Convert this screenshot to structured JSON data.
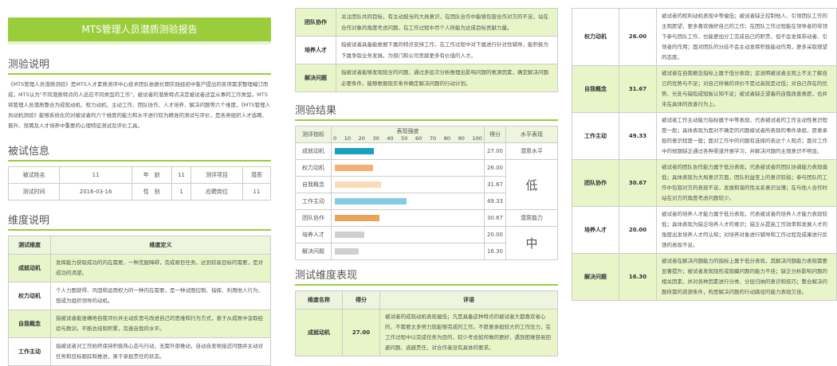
{
  "report_title": "MTS管理人员潜质测验报告",
  "section_intro": "测验说明",
  "intro_text": "《MTS管理人员潜质测验》是MTS人才素质测评中心技术团队依据长期实践经验中客户提出的各项需求整理编订而成，MTS认为\"不同潜质特点的人适应不同类型的工作\"，被试者的潜质特点决定被试者适宜从事的工作类型。MTS将管理人员潜质整合为成就动机、权力动机、主动工作、团队协作、人才培养、解决问题等六个维度，《MTS管理人员动机测验》能够系统化的对被试者的六个维度的能力和水平进行较为精准的测试与评价，是各类组织人才选聘、晋升、竞聘及人才培养中重要的心理特征测试及评价工具。",
  "section_info": "被试信息",
  "info": {
    "name_label": "被试姓名",
    "name": "11",
    "age_label": "年　龄",
    "age": "11",
    "item_label": "测评项目",
    "item": "潜质",
    "time_label": "测试时间",
    "time": "2016-03-16",
    "gender_label": "性　别",
    "gender": "1",
    "position_label": "应聘岗位",
    "position": "11"
  },
  "section_dim": "维度说明",
  "dim_header": {
    "name": "测试维度",
    "def": "维度定义"
  },
  "dimensions": [
    {
      "name": "成就动机",
      "def": "发挥能力获取成功的内在需要，一种克服障碍，完成艰巨任务，达到较高目标的需要，是对成功的渴望。"
    },
    {
      "name": "权力动机",
      "def": "个人力图获得、巩固和运用权力的一种内在需要，是一种试图控制、指挥、利用他人行为，想成为组织领导的动机。"
    },
    {
      "name": "自我概念",
      "def": "指被试者能准确地自我评价并主动反思与改进自己的思维和行为方式，善于从成败中汲取经验与教训，不断总结和积累，完善自我的水平。"
    },
    {
      "name": "工作主动",
      "def": "指被试者对工作始终保持积极热心态与行动，无需外部推动，自动自发地接近问题并主动对任务和目标跟踪和推进，勇于承担责任的状态。"
    }
  ],
  "dimensions_cont": [
    {
      "name": "团队协作",
      "def": "关注团队共同目标，有主动担当的大局意识，在团队合作中能够包容合作对方的不足，站在合作对象的角度考虑问题，在工作过程中尽个人所能为达成目标贡献力量。"
    },
    {
      "name": "培养人才",
      "def": "指被试者具备能根据下属的特点安排工作，在工作过程中对下属进行针对性辅导，能积极为下属争取业务发展。为部门和公司贡献更多有价值的人才。"
    },
    {
      "name": "解决问题",
      "def": "指被试者能够发现隐含的问题，通过多层次分析推理出影响问题的根源因素，确定解决问题必要条件，能够根据现实条件确定解决问题的行动计划。"
    }
  ],
  "section_result": "测验结果",
  "result_header": {
    "indicator": "测评指标",
    "strength": "表现强度",
    "score": "得分",
    "level": "水平表现"
  },
  "chart_data": {
    "type": "bar",
    "orientation": "horizontal",
    "xlabel": "表现强度",
    "xlim": [
      0,
      100
    ],
    "ticks": [
      "0",
      "10",
      "20",
      "30",
      "40",
      "50",
      "60",
      "70",
      "80",
      "90",
      "100"
    ],
    "categories": [
      "成就动机",
      "权力动机",
      "自我概念",
      "工作主动",
      "团队协作",
      "培养人才",
      "解决问题"
    ],
    "values": [
      27.0,
      26.0,
      31.67,
      49.33,
      30.67,
      20.0,
      16.3
    ],
    "score_labels": [
      "27.00",
      "26.00",
      "31.67",
      "49.33",
      "30.67",
      "20.00",
      "16.30"
    ],
    "colors": [
      "#1aa0c2",
      "#f3ae74",
      "#fcdcb8",
      "#84cbe8",
      "#e8a45a",
      "#cfcfcf",
      "#cfcfcf"
    ]
  },
  "levels": {
    "l1": "潜质水平",
    "l2": "低",
    "l3": "潜质能力",
    "l4": "中"
  },
  "section_eval": "测试维度表现",
  "eval_header": {
    "name": "维度名称",
    "score": "得分",
    "comment": "评语"
  },
  "evaluations": [
    {
      "name": "成就动机",
      "score": "27.00",
      "comment": "被试者的成就动机表现偏低；凡是具备这种特点的被试者大都喜欢省心的、不需要太多努力就能够完成的工作。不愿意承担较大的工作压力，在工作过程中以完成任务为目的，较少考虑如何做的更好，遇到困难容易回避问题、逃避责任，对合作者没有具体的要求。"
    },
    {
      "name": "权力动机",
      "score": "26.00",
      "comment": "被试者的权利动机表现中等偏低；被试者缺乏控制他人、引领团队工作的主观愿望，更多喜欢做好自己的工作；在团队工作过程能在领导者的带领下参与团队工作，也能更加分工完成自己的职责，但不会发挥带动者、引领者的作用；面对团队的分歧不会主动发挥积极能动作用，更多采取观望的态度。"
    },
    {
      "name": "自我概念",
      "score": "31.67",
      "comment": "被试者在自我概念指标上属于低分表现；这说明被试者主观上不太了解自己的优势与不足；对自己所做的评价不是过高就是过低；对自己存在的优势、长处与缺陷成短板认知不足；被试者缺乏望着的自我改善意愿，也并未在具体的改善行为上。"
    },
    {
      "name": "工作主动",
      "score": "49.33",
      "comment": "被试者工作主动能力指标属于中等表现，代表被试者的工作主动性意识程度一般；具体表现为面对不确定的问题被试者所表现的事件承担，愿意承担的意识程度一般；面对工作中的问题有选择的表达个人观点；面对工作中的规题缺乏通过各种渠道开展学习，并解决问题的主观意识不明显。"
    },
    {
      "name": "团队协作",
      "score": "30.67",
      "comment": "被试者的团队协作能力属于低分表现，代表被试者的团队协调能力表现偏低；具体表现为大局意识方面，团队利益至上的意识较弱；参与团队的工作中包容对方的表现不足，发展和谐的性关系意识淡薄；在与他人合作时站在对方的角度考虑问题较少。"
    },
    {
      "name": "培养人才",
      "score": "20.00",
      "comment": "被试者的培养人才能力属于低分表现，代表被试者的培养人才能力表现较低；具体表现为缺乏培养人才的意识；缺乏从提高工作效率和发展人才的角度出发培养人才的认知；对培养对象进行辅导和工作过程及成果进行反馈的表现不足。"
    },
    {
      "name": "解决问题",
      "score": "16.30",
      "comment": "被试者在解决问题能力的指标上属于低分表现，其解决问题能力表现需要显著提升；被试者发现隐形或隐藏问题的能力不佳；缺乏分析影响问题的相关因素，并对各种因素进行分类、分层归纳的意识和技巧；整合解决问题所需的资源条件，构思解决问题的行动路径的能力表现欠佳。"
    }
  ]
}
